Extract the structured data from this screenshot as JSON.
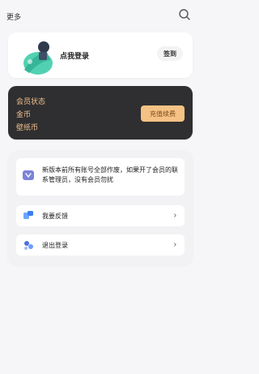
{
  "header": {
    "title": "更多",
    "search_icon": "search-icon"
  },
  "profile": {
    "login_text": "点我登录",
    "signin_label": "签到",
    "avatar_icon": "avatar-illustration-icon"
  },
  "member": {
    "status_label": "会员状态",
    "coins_label": "金币",
    "wallpaper_coins_label": "壁纸币",
    "renew_label": "充值续费",
    "accent": "#f0c08b",
    "button_color": "#f6c184"
  },
  "notice": {
    "text": "新版本前所有账号全部作废，如果开了会员的联系管理员，没有会员勿扰",
    "icon": "notice-icon"
  },
  "menu": [
    {
      "label": "我要反馈",
      "icon": "feedback-icon"
    },
    {
      "label": "退出登录",
      "icon": "logout-icon"
    }
  ]
}
